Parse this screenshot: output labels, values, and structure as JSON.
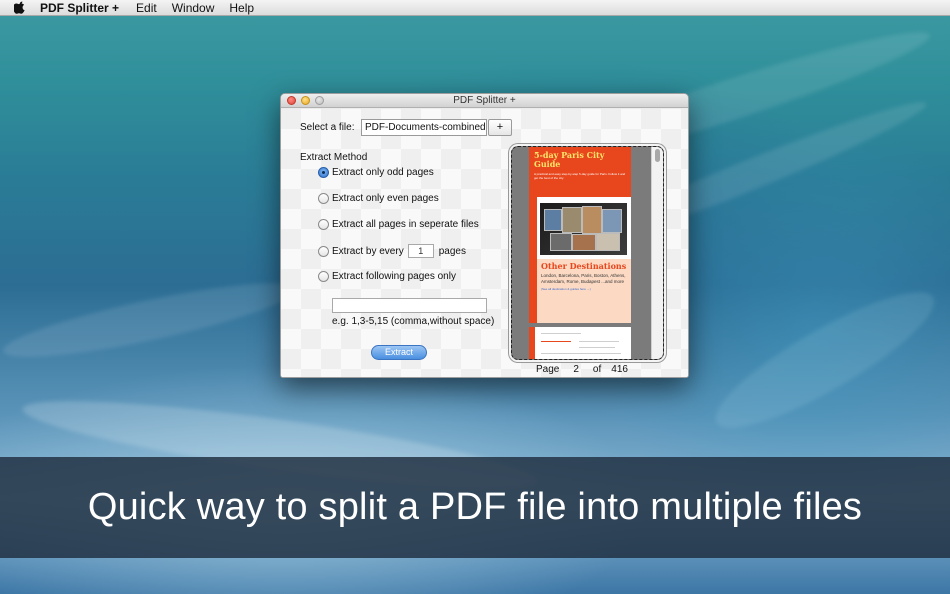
{
  "menubar": {
    "app_name": "PDF Splitter +",
    "items": [
      "Edit",
      "Window",
      "Help"
    ]
  },
  "window": {
    "title": "PDF Splitter +",
    "select_file_label": "Select a file:",
    "file_value": "PDF-Documents-combined",
    "add_button": "+",
    "extract_method_label": "Extract Method",
    "options": [
      {
        "label": "Extract only odd pages",
        "checked": true
      },
      {
        "label": "Extract only even pages",
        "checked": false
      },
      {
        "label": "Extract all pages in seperate files",
        "checked": false
      },
      {
        "label": "Extract by every",
        "checked": false
      },
      {
        "label": "Extract following pages only",
        "checked": false
      }
    ],
    "every_value": "1",
    "every_suffix": "pages",
    "pages_field_value": "",
    "example_text": "e.g. 1,3-5,15 (comma,without space)",
    "extract_button": "Extract",
    "pager": {
      "label": "Page",
      "current": "2",
      "of_label": "of",
      "total": "416"
    }
  },
  "preview_doc": {
    "title": "5-day Paris City Guide",
    "subtitle": "A practical and easy step-by-step 5-day guide for Paris. Follow it and get the best of the city.",
    "section_heading": "Other Destinations",
    "section_body": "London, Barcelona, Paris, Boston, Athens, Amsterdam, Rome, Budapest ...and more",
    "link_text": "(See all destination & guides here →)"
  },
  "caption": "Quick way to split a PDF file into multiple files",
  "colors": {
    "accent": "#2f72d1",
    "doc_orange": "#e8461c",
    "banner": "#1e2d3e"
  }
}
